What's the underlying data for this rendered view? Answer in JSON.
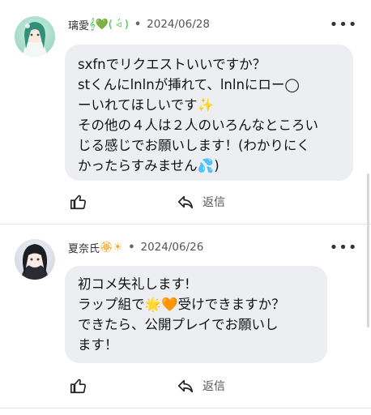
{
  "comments": [
    {
      "author": "璃愛",
      "author_emojis": "𝄞💚( ◃́ )",
      "separator": "•",
      "date": "2024/06/28",
      "more_label": "•••",
      "lines": [
        "sxfnでリクエストいいですか？",
        "stくんにlnlnが挿れて、lnlnにロー◯",
        "ーいれてほしいです✨",
        "その他の４人は２人のいろんなところい",
        "じる感じでお願いします！(わかりにく",
        "かったらすみません💦)"
      ],
      "reply_label": "返信"
    },
    {
      "author": "夏奈氏",
      "author_emojis": "🏵☀",
      "separator": "•",
      "date": "2024/06/26",
      "more_label": "•••",
      "lines": [
        "初コメ失礼します!",
        "ラップ組で🌟🧡受けできますか？",
        "できたら、公開プレイでお願いし",
        "ます！"
      ],
      "reply_label": "返信"
    }
  ]
}
